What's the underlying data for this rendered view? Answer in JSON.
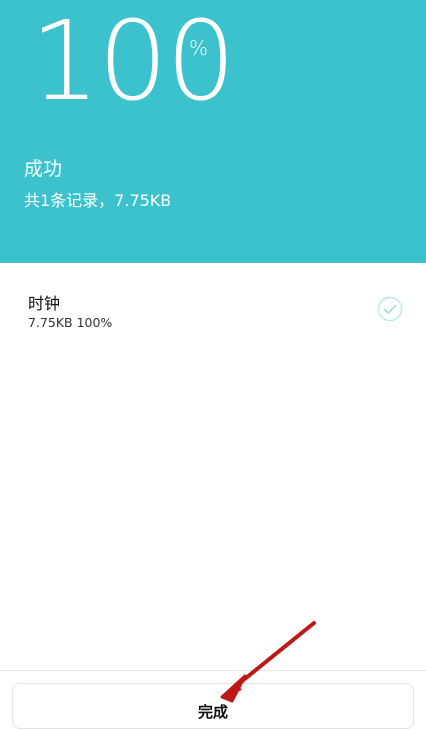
{
  "header": {
    "percent_value": "100",
    "percent_unit": "%",
    "status": "成功",
    "summary": "共1条记录，7.75KB",
    "bg_color": "#3cc2cc"
  },
  "items": [
    {
      "name": "时钟",
      "detail": "7.75KB 100%",
      "icon": "check-circle-icon"
    }
  ],
  "footer": {
    "done_label": "完成"
  },
  "annotation": {
    "arrow_color": "#c01818"
  }
}
